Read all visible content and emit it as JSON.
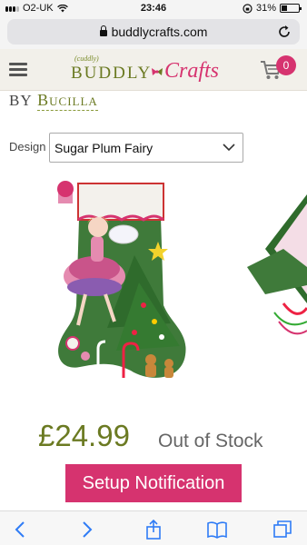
{
  "status_bar": {
    "carrier": "O2-UK",
    "time": "23:46",
    "battery_text": "31%",
    "battery_level": 0.31
  },
  "browser": {
    "url": "buddlycrafts.com"
  },
  "site_header": {
    "logo_small": "(cuddly)",
    "logo_main": "BUDDLY",
    "logo_script": "Crafts",
    "cart_count": "0"
  },
  "product": {
    "by_label": "BY",
    "brand": "Bucilla",
    "design_label": "Design",
    "design_value": "Sugar Plum Fairy",
    "price": "£24.99",
    "stock_status": "Out of Stock",
    "notify_button": "Setup Notification"
  },
  "colors": {
    "accent_pink": "#d6336f",
    "brand_green": "#6b7a22"
  },
  "toolbar": {
    "icons": [
      "back-icon",
      "forward-icon",
      "share-icon",
      "bookmarks-icon",
      "tabs-icon"
    ]
  }
}
